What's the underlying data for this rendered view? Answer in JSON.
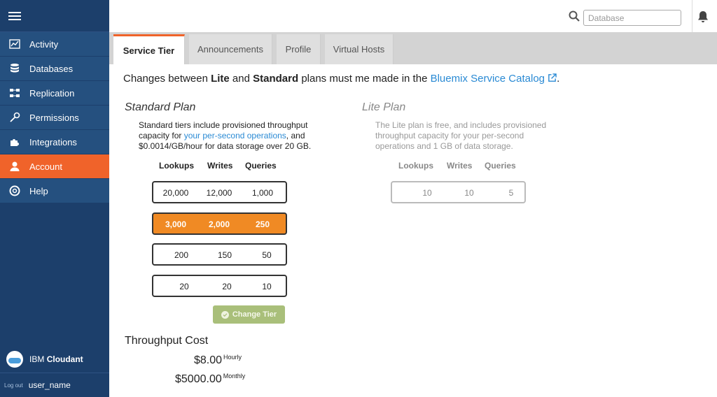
{
  "sidebar": {
    "items": [
      {
        "label": "Activity",
        "icon": "activity-icon"
      },
      {
        "label": "Databases",
        "icon": "databases-icon"
      },
      {
        "label": "Replication",
        "icon": "replication-icon"
      },
      {
        "label": "Permissions",
        "icon": "key-icon"
      },
      {
        "label": "Integrations",
        "icon": "puzzle-icon"
      },
      {
        "label": "Account",
        "icon": "user-icon",
        "active": true
      },
      {
        "label": "Help",
        "icon": "lifebuoy-icon"
      }
    ],
    "brand_prefix": "IBM",
    "brand_name": "Cloudant",
    "logout_label": "Log out",
    "username": "user_name"
  },
  "topbar": {
    "search_placeholder": "Database"
  },
  "tabs": [
    {
      "label": "Service Tier",
      "active": true
    },
    {
      "label": "Announcements"
    },
    {
      "label": "Profile"
    },
    {
      "label": "Virtual Hosts"
    }
  ],
  "notice": {
    "prefix": "Changes between ",
    "lite": "Lite",
    "and": " and ",
    "standard": "Standard",
    "middle": " plans must me made in the ",
    "link": "Bluemix Service Catalog",
    "suffix": "."
  },
  "standard_plan": {
    "title": "Standard Plan",
    "desc_before": "Standard tiers include provisioned throughput capacity for ",
    "desc_link": "your per-second operations",
    "desc_after": ", and $0.0014/GB/hour for data storage over 20 GB.",
    "columns": [
      "Lookups",
      "Writes",
      "Queries"
    ],
    "tiers": [
      {
        "lookups": "20,000",
        "writes": "12,000",
        "queries": "1,000"
      },
      {
        "lookups": "3,000",
        "writes": "2,000",
        "queries": "250",
        "selected": true
      },
      {
        "lookups": "200",
        "writes": "150",
        "queries": "50"
      },
      {
        "lookups": "20",
        "writes": "20",
        "queries": "10"
      }
    ],
    "change_button": "Change Tier"
  },
  "lite_plan": {
    "title": "Lite Plan",
    "desc": "The Lite plan is free, and includes provisioned throughput capacity for your per-second operations and 1 GB of data storage.",
    "columns": [
      "Lookups",
      "Writes",
      "Queries"
    ],
    "tier": {
      "lookups": "10",
      "writes": "10",
      "queries": "5"
    }
  },
  "throughput_cost": {
    "title": "Throughput Cost",
    "hourly_value": "$8.00",
    "hourly_unit": "Hourly",
    "monthly_value": "$5000.00",
    "monthly_unit": "Monthly"
  },
  "colors": {
    "sidebar_bg": "#1c3f6b",
    "nav_item_bg": "#25507f",
    "accent": "#f0632a",
    "selected_tier": "#f08a24",
    "link": "#2a8ad4",
    "change_button": "#a9bf7a"
  }
}
